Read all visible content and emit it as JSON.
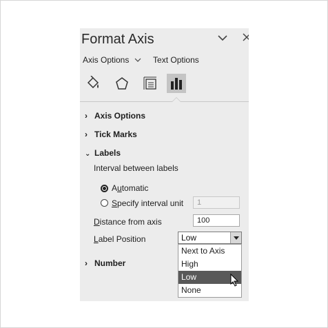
{
  "pane": {
    "title": "Format Axis",
    "controls": {
      "collapse_icon": "chevron-down-icon",
      "close_icon": "close-icon"
    }
  },
  "tabs": [
    {
      "label": "Axis Options",
      "selected": true
    },
    {
      "label": "Text Options",
      "selected": false
    }
  ],
  "category_icons": [
    {
      "name": "fill-line-icon",
      "active": false
    },
    {
      "name": "effects-pentagon-icon",
      "active": false
    },
    {
      "name": "size-properties-icon",
      "active": false
    },
    {
      "name": "axis-options-bars-icon",
      "active": true
    }
  ],
  "sections": {
    "axis_options": {
      "label": "Axis Options",
      "expanded": false
    },
    "tick_marks": {
      "label": "Tick Marks",
      "expanded": false
    },
    "labels": {
      "label": "Labels",
      "expanded": true
    },
    "number": {
      "label": "Number",
      "expanded": false
    }
  },
  "labels_section": {
    "interval_heading": "Interval between labels",
    "automatic": {
      "prefix": "A",
      "accel": "u",
      "rest": "tomatic",
      "checked": true
    },
    "specify": {
      "accel": "S",
      "rest": "pecify interval unit",
      "checked": false,
      "value": "1"
    },
    "distance": {
      "accel": "D",
      "rest": "istance from axis",
      "value": "100"
    },
    "label_position": {
      "accel": "L",
      "rest": "abel Position",
      "selected": "Low"
    },
    "dropdown_options": [
      "Next to Axis",
      "High",
      "Low",
      "None"
    ],
    "highlighted_option": "Low"
  },
  "colors": {
    "pane_bg": "#ececec",
    "highlight": "#595959",
    "active_icon_bg": "#c4c4c4"
  }
}
